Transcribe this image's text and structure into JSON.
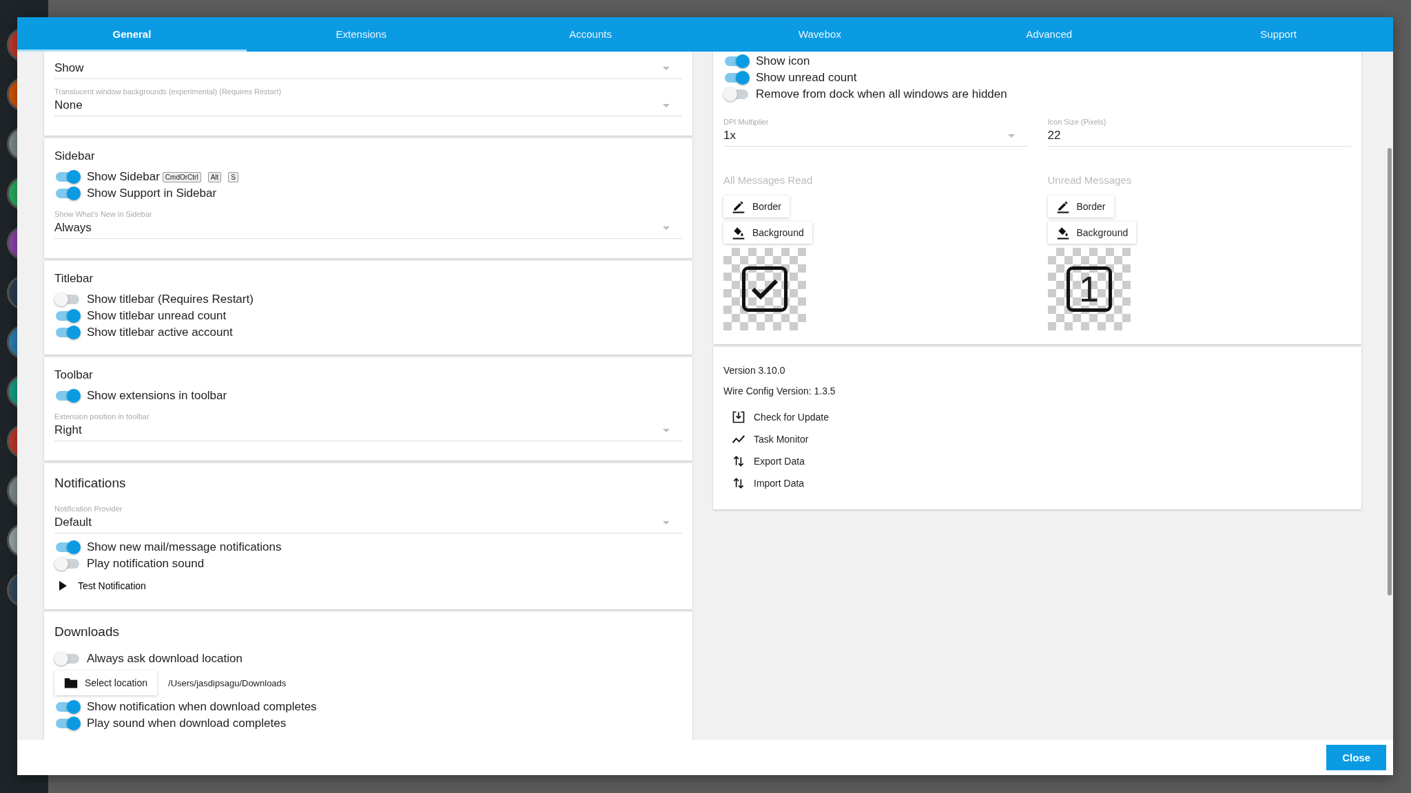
{
  "tabs": [
    {
      "label": "General",
      "selected": true
    },
    {
      "label": "Extensions",
      "selected": false
    },
    {
      "label": "Accounts",
      "selected": false
    },
    {
      "label": "Wavebox",
      "selected": false
    },
    {
      "label": "Advanced",
      "selected": false
    },
    {
      "label": "Support",
      "selected": false
    }
  ],
  "left_sections": [
    {
      "items": [
        {
          "kind": "select",
          "value": "Show"
        },
        {
          "kind": "select",
          "label": "Translucent window backgrounds (experimental) (Requires Restart)",
          "value": "None"
        }
      ]
    },
    {
      "title": "Sidebar",
      "big": false,
      "items": [
        {
          "kind": "toggle",
          "label": "Show Sidebar",
          "on": true,
          "keys": [
            "CmdOrCtrl",
            "Alt",
            "S"
          ]
        },
        {
          "kind": "toggle",
          "label": "Show Support in Sidebar",
          "on": true
        },
        {
          "kind": "select",
          "label": "Show What's New in Sidebar",
          "value": "Always"
        }
      ]
    },
    {
      "title": "Titlebar",
      "big": false,
      "items": [
        {
          "kind": "toggle",
          "label": "Show titlebar (Requires Restart)",
          "on": false
        },
        {
          "kind": "toggle",
          "label": "Show titlebar unread count",
          "on": true
        },
        {
          "kind": "toggle",
          "label": "Show titlebar active account",
          "on": true
        }
      ]
    },
    {
      "title": "Toolbar",
      "big": false,
      "items": [
        {
          "kind": "toggle",
          "label": "Show extensions in toolbar",
          "on": true
        },
        {
          "kind": "select",
          "label": "Extension position in toolbar",
          "value": "Right"
        }
      ]
    },
    {
      "title": "Notifications",
      "big": true,
      "items": [
        {
          "kind": "select",
          "label": "Notification Provider",
          "value": "Default"
        },
        {
          "kind": "toggle",
          "label": "Show new mail/message notifications",
          "on": true
        },
        {
          "kind": "toggle",
          "label": "Play notification sound",
          "on": false
        },
        {
          "kind": "action",
          "label": "Test Notification"
        }
      ]
    },
    {
      "title": "Downloads",
      "big": true,
      "items": [
        {
          "kind": "toggle",
          "label": "Always ask download location",
          "on": false
        },
        {
          "kind": "location",
          "button": "Select location",
          "path": "/Users/jasdipsagu/Downloads"
        },
        {
          "kind": "toggle",
          "label": "Show notification when download completes",
          "on": true
        },
        {
          "kind": "toggle",
          "label": "Play sound when download completes",
          "on": true
        }
      ]
    }
  ],
  "tray": {
    "toggles": [
      {
        "label": "Show icon",
        "on": true
      },
      {
        "label": "Show unread count",
        "on": true
      },
      {
        "label": "Remove from dock when all windows are hidden",
        "on": false
      }
    ],
    "dpi": {
      "label": "DPI Multiplier",
      "value": "1x"
    },
    "icon_size": {
      "label": "Icon Size (Pixels)",
      "value": "22"
    },
    "groups": [
      {
        "title": "All Messages Read",
        "buttons": [
          {
            "kind": "border",
            "label": "Border"
          },
          {
            "kind": "background",
            "label": "Background"
          }
        ],
        "preview": {
          "kind": "tick"
        }
      },
      {
        "title": "Unread Messages",
        "buttons": [
          {
            "kind": "border",
            "label": "Border"
          },
          {
            "kind": "background",
            "label": "Background"
          }
        ],
        "preview": {
          "kind": "number",
          "text": "1"
        }
      }
    ]
  },
  "about": {
    "lines": [
      "Version 3.10.0",
      "Wire Config Version: 1.3.5"
    ],
    "actions": [
      {
        "kind": "update",
        "label": "Check for Update"
      },
      {
        "kind": "monitor",
        "label": "Task Monitor"
      },
      {
        "kind": "transfer",
        "label": "Export Data"
      },
      {
        "kind": "transfer",
        "label": "Import Data"
      }
    ]
  },
  "footer": {
    "close": "Close"
  }
}
